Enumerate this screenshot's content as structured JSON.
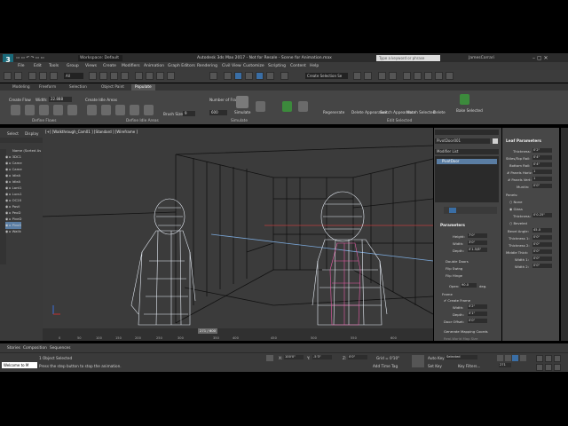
{
  "title_bar": {
    "logo": "3",
    "workspace": "Workspace: Default",
    "title": "Autodesk 3ds Max 2017 - Not for Resale - Scene for Animation.max",
    "search_placeholder": "Type a keyword or phrase",
    "user": "JamesCorrari"
  },
  "menu": [
    "File",
    "Edit",
    "Tools",
    "Group",
    "Views",
    "Create",
    "Modifiers",
    "Animation",
    "Graph Editors",
    "Rendering",
    "Civil View",
    "Customize",
    "Scripting",
    "Content",
    "Help"
  ],
  "toolbar": {
    "selection_filter": "All",
    "named_selection": "Create Selection Se"
  },
  "ribbon_tabs": [
    "Modeling",
    "Freeform",
    "Selection",
    "Object Paint",
    "Populate"
  ],
  "ribbon": {
    "create_flow": "Create Flow",
    "width_label": "Width:",
    "width_value": "22.888",
    "create_idle_areas": "Create Idle Areas",
    "brush_size": "Brush Size",
    "brush_value": "9",
    "number_of_frames_label": "Number of Frames",
    "number_of_frames": "600",
    "simulate": "Simulate",
    "groups": [
      "Define Flows",
      "Define Idle Areas",
      "Simulate",
      "Edit Selected"
    ],
    "edit_items": [
      "Regenerate",
      "Delete Appearance",
      "Switch Appearance",
      "Match Selected",
      "Delete",
      "Bake Selected"
    ]
  },
  "explorer": {
    "tabs": [
      "Select",
      "Display"
    ],
    "header": "Name (Sorted As",
    "items": [
      "3DC1",
      "Came",
      "Came",
      "IdleA",
      "IdleA",
      "Lant1",
      "Lucs1",
      "OC20",
      "Pavil",
      "PeoD",
      "PiveD",
      "Pivo0",
      "Wallk"
    ]
  },
  "viewport": {
    "label": "[+] [Walkthrough_Cam01 ] [Standard ] [Wireframe ]"
  },
  "command_panel": {
    "object_name": "PivotDoor001",
    "modifier_list": "Modifier List",
    "stack_item": "PivotDoor",
    "parameters_title": "Parameters",
    "height_label": "Height:",
    "height_value": "7'0\"",
    "width_label": "Width:",
    "width_value": "3'0\"",
    "depth_label": "Depth:",
    "depth_value": "0'1.5/8\"",
    "double_doors": "Double Doors",
    "flip_swing": "Flip Swing",
    "flip_hinge": "Flip Hinge",
    "open_label": "Open:",
    "open_value": "90.0",
    "open_unit": "deg.",
    "frame_title": "Frame",
    "create_frame": "Create Frame",
    "frame_width_label": "Width:",
    "frame_width_value": "0'2\"",
    "frame_depth_label": "Depth:",
    "frame_depth_value": "0'1\"",
    "door_offset_label": "Door Offset:",
    "door_offset_value": "0'0\"",
    "gen_mapping": "Generate Mapping Coords",
    "real_world": "Real-World Map Size"
  },
  "leaf_params": {
    "title": "Leaf Parameters",
    "rows": [
      {
        "label": "Thickness:",
        "value": "0'2\""
      },
      {
        "label": "Stiles/Top Rail:",
        "value": "0'4\""
      },
      {
        "label": "Bottom Rail:",
        "value": "0'4\""
      },
      {
        "label": "# Panels Horiz:",
        "value": "1"
      },
      {
        "label": "# Panels Vert:",
        "value": "1"
      },
      {
        "label": "Muntin:",
        "value": "0'0\""
      }
    ],
    "panels_title": "Panels:",
    "panel_options": [
      "None",
      "Glass",
      "Beveled"
    ],
    "thickness_label": "Thickness:",
    "thickness_value": "0'0.25\"",
    "bevel_rows": [
      {
        "label": "Bevel Angle:",
        "value": "45.0"
      },
      {
        "label": "Thickness 1:",
        "value": "0'0\""
      },
      {
        "label": "Thickness 2:",
        "value": "0'0\""
      },
      {
        "label": "Middle Thick:",
        "value": "0'0\""
      },
      {
        "label": "Width 1:",
        "value": "0'0\""
      },
      {
        "label": "Width 2:",
        "value": "0'0\""
      }
    ]
  },
  "timeline": {
    "slider": "271 / 600",
    "ticks": [
      "0",
      "50",
      "100",
      "150",
      "200",
      "250",
      "300",
      "350",
      "400",
      "450",
      "500",
      "550",
      "600"
    ]
  },
  "status": {
    "tabs": [
      "Stories",
      "Composition",
      "Sequences"
    ],
    "maxscript": "Welcome to M",
    "selected": "1 Object Selected",
    "prompt": "Press the step button to stop the animation.",
    "x_label": "X:",
    "x_value": "100'0\"",
    "y_label": "Y:",
    "y_value": "-5'3\"",
    "z_label": "Z:",
    "z_value": "0'0\"",
    "grid": "Grid = 0'10\"",
    "add_time_tag": "Add Time Tag",
    "auto_key": "Auto Key",
    "set_key": "Set Key",
    "selected_dropdown": "Selected",
    "key_filters": "Key Filters...",
    "frame": "271"
  }
}
